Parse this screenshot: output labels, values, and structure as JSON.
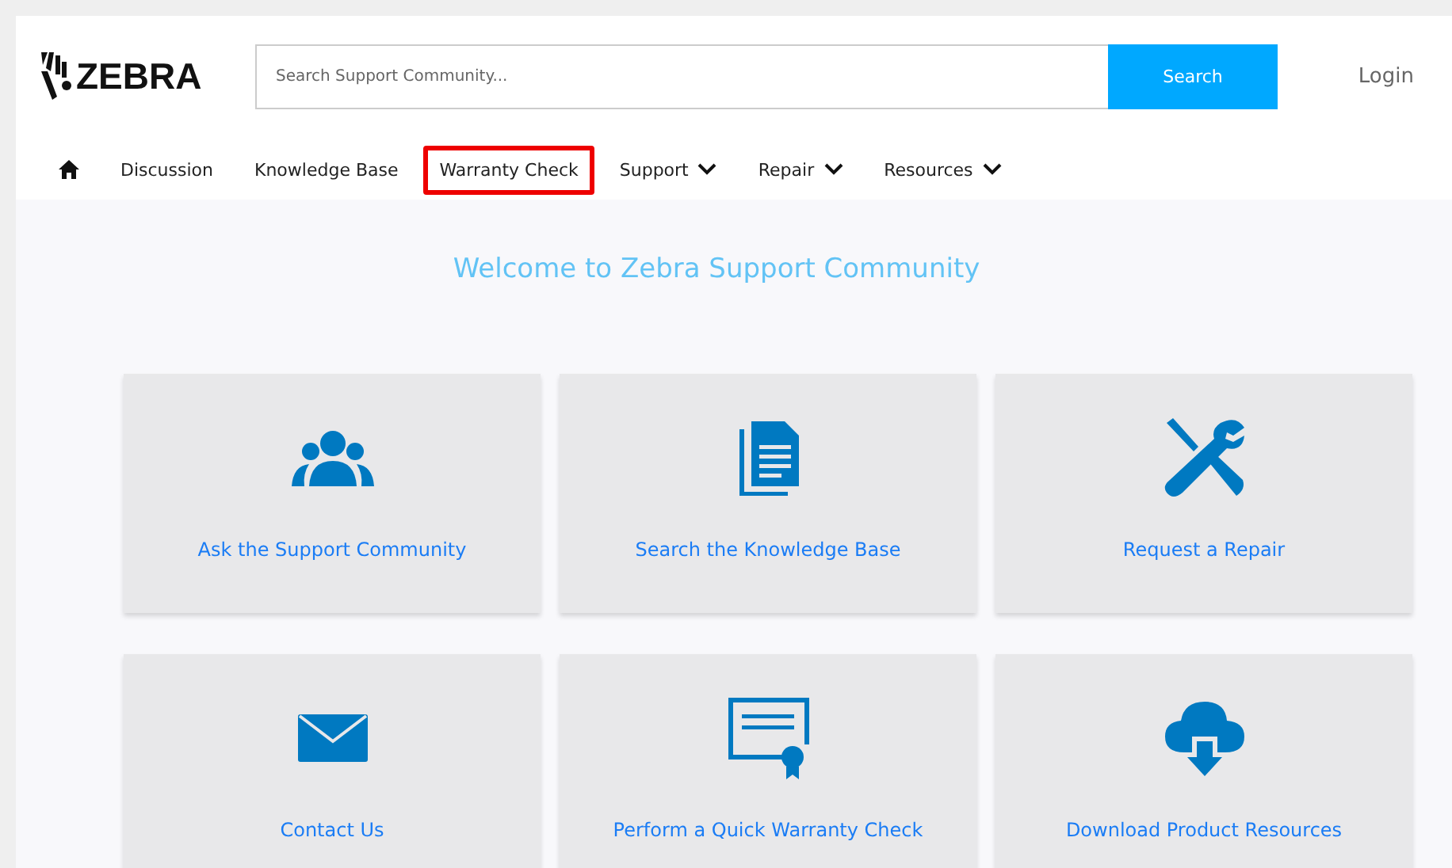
{
  "logo": {
    "text": "ZEBRA"
  },
  "search": {
    "placeholder": "Search Support Community...",
    "button": "Search"
  },
  "login": "Login",
  "nav": [
    {
      "kind": "home",
      "highlighted": false
    },
    {
      "kind": "link",
      "label": "Discussion",
      "highlighted": false
    },
    {
      "kind": "link",
      "label": "Knowledge Base",
      "highlighted": false
    },
    {
      "kind": "link",
      "label": "Warranty Check",
      "highlighted": true
    },
    {
      "kind": "menu",
      "label": "Support",
      "highlighted": false
    },
    {
      "kind": "menu",
      "label": "Repair",
      "highlighted": false
    },
    {
      "kind": "menu",
      "label": "Resources",
      "highlighted": false
    }
  ],
  "title": "Welcome to Zebra Support Community",
  "cards": [
    {
      "kind": "people",
      "label": "Ask the Support Community"
    },
    {
      "kind": "document",
      "label": "Search the Knowledge Base"
    },
    {
      "kind": "tools",
      "label": "Request a Repair"
    },
    {
      "kind": "envelope",
      "label": "Contact Us"
    },
    {
      "kind": "certificate",
      "label": "Perform a Quick Warranty Check"
    },
    {
      "kind": "cloud",
      "label": "Download Product Resources"
    }
  ]
}
